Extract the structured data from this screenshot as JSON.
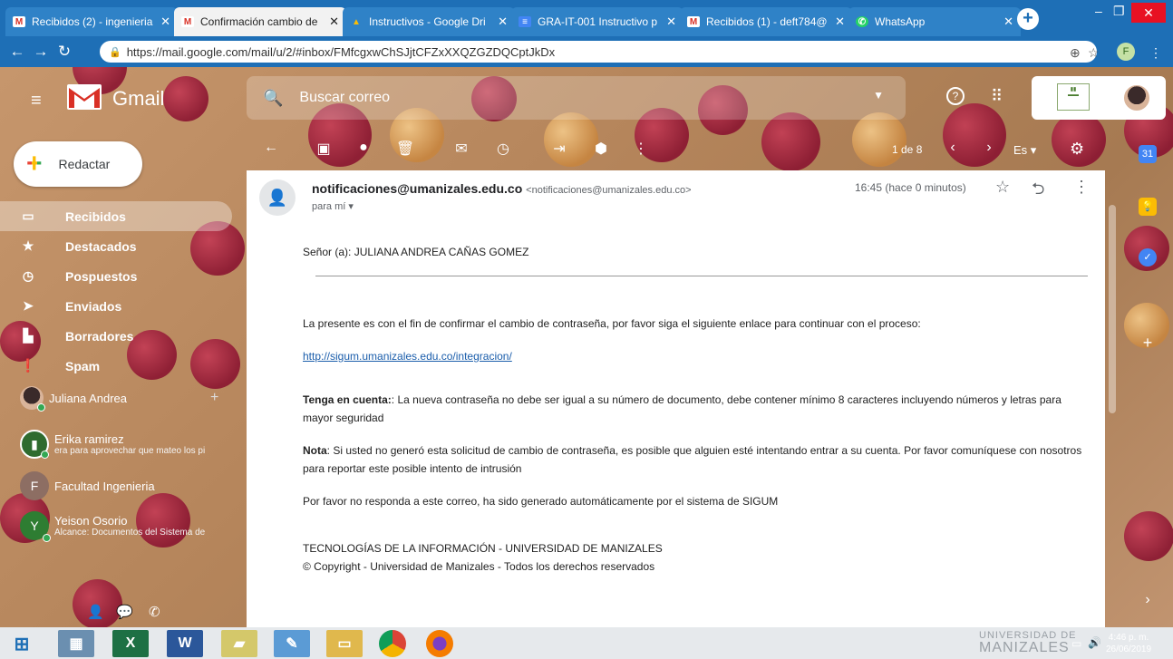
{
  "browser": {
    "tabs": [
      {
        "title": "Recibidos (2) - ingenieria",
        "icon": "gmail-icon",
        "active": false
      },
      {
        "title": "Confirmación cambio de",
        "icon": "gmail-icon",
        "active": true
      },
      {
        "title": "Instructivos - Google Dri",
        "icon": "drive-icon",
        "active": false
      },
      {
        "title": "GRA-IT-001 Instructivo p",
        "icon": "docs-icon",
        "active": false
      },
      {
        "title": "Recibidos (1) - deft784@",
        "icon": "gmail-icon",
        "active": false
      },
      {
        "title": "WhatsApp",
        "icon": "whatsapp-icon",
        "active": false
      }
    ],
    "url": "https://mail.google.com/mail/u/2/#inbox/FMfcgxwChSJjtCFZxXXQZGZDQCptJkDx",
    "profile_initial": "F"
  },
  "gmail": {
    "brand": "Gmail",
    "search_placeholder": "Buscar correo",
    "compose_label": "Redactar",
    "nav": [
      {
        "label": "Recibidos",
        "icon": "inbox-icon",
        "active": true
      },
      {
        "label": "Destacados",
        "icon": "star-icon",
        "active": false
      },
      {
        "label": "Pospuestos",
        "icon": "clock-icon",
        "active": false
      },
      {
        "label": "Enviados",
        "icon": "send-icon",
        "active": false
      },
      {
        "label": "Borradores",
        "icon": "draft-icon",
        "active": false
      },
      {
        "label": "Spam",
        "icon": "spam-icon",
        "active": false
      }
    ],
    "chats": [
      {
        "name": "Juliana Andrea",
        "sub": "",
        "initial": "",
        "color": "#3a2a2a"
      },
      {
        "name": "Erika ramirez",
        "sub": "era para aprovechar que mateo los pi",
        "initial": "",
        "color": "#2f6b2f"
      },
      {
        "name": "Facultad Ingenieria",
        "sub": "",
        "initial": "F",
        "color": "#8d6e63"
      },
      {
        "name": "Yeison Osorio",
        "sub": "Alcance: Documentos del Sistema de",
        "initial": "Y",
        "color": "#2e7d32"
      }
    ],
    "pager": "1 de 8",
    "language": "Es"
  },
  "message": {
    "sender_name": "notificaciones@umanizales.edu.co",
    "sender_email": "<notificaciones@umanizales.edu.co>",
    "to": "para mí",
    "time": "16:45 (hace 0 minutos)",
    "greeting": "Señor (a): JULIANA ANDREA CAÑAS GOMEZ",
    "paragraph1": "La presente es con el fin de confirmar el cambio de contraseña, por favor siga el siguiente enlace para continuar con el proceso:",
    "link": "http://sigum.umanizales.edu.co/integracion/",
    "note1_label": "Tenga en cuenta:",
    "note1_text": ": La nueva contraseña no debe ser igual a su número de documento, debe contener mínimo 8 caracteres incluyendo números y letras para mayor seguridad",
    "note2_label": "Nota",
    "note2_text": ": Si usted no generó esta solicitud de cambio de contraseña, es posible que alguien esté intentando entrar a su cuenta. Por favor comuníquese con nosotros para reportar este posible intento de intrusión",
    "paragraph_auto": "Por favor  no responda a este correo, ha sido generado automáticamente por el sistema de SIGUM",
    "footer_line1": "TECNOLOGÍAS DE LA INFORMACIÓN - UNIVERSIDAD DE MANIZALES",
    "footer_line2": "© Copyright - Universidad de Manizales - Todos los derechos reservados"
  },
  "taskbar": {
    "tray_brand_line1": "UNIVERSIDAD DE",
    "tray_brand_line2": "MANIZALES",
    "time": "4:46 p. m.",
    "date": "26/06/2019"
  }
}
